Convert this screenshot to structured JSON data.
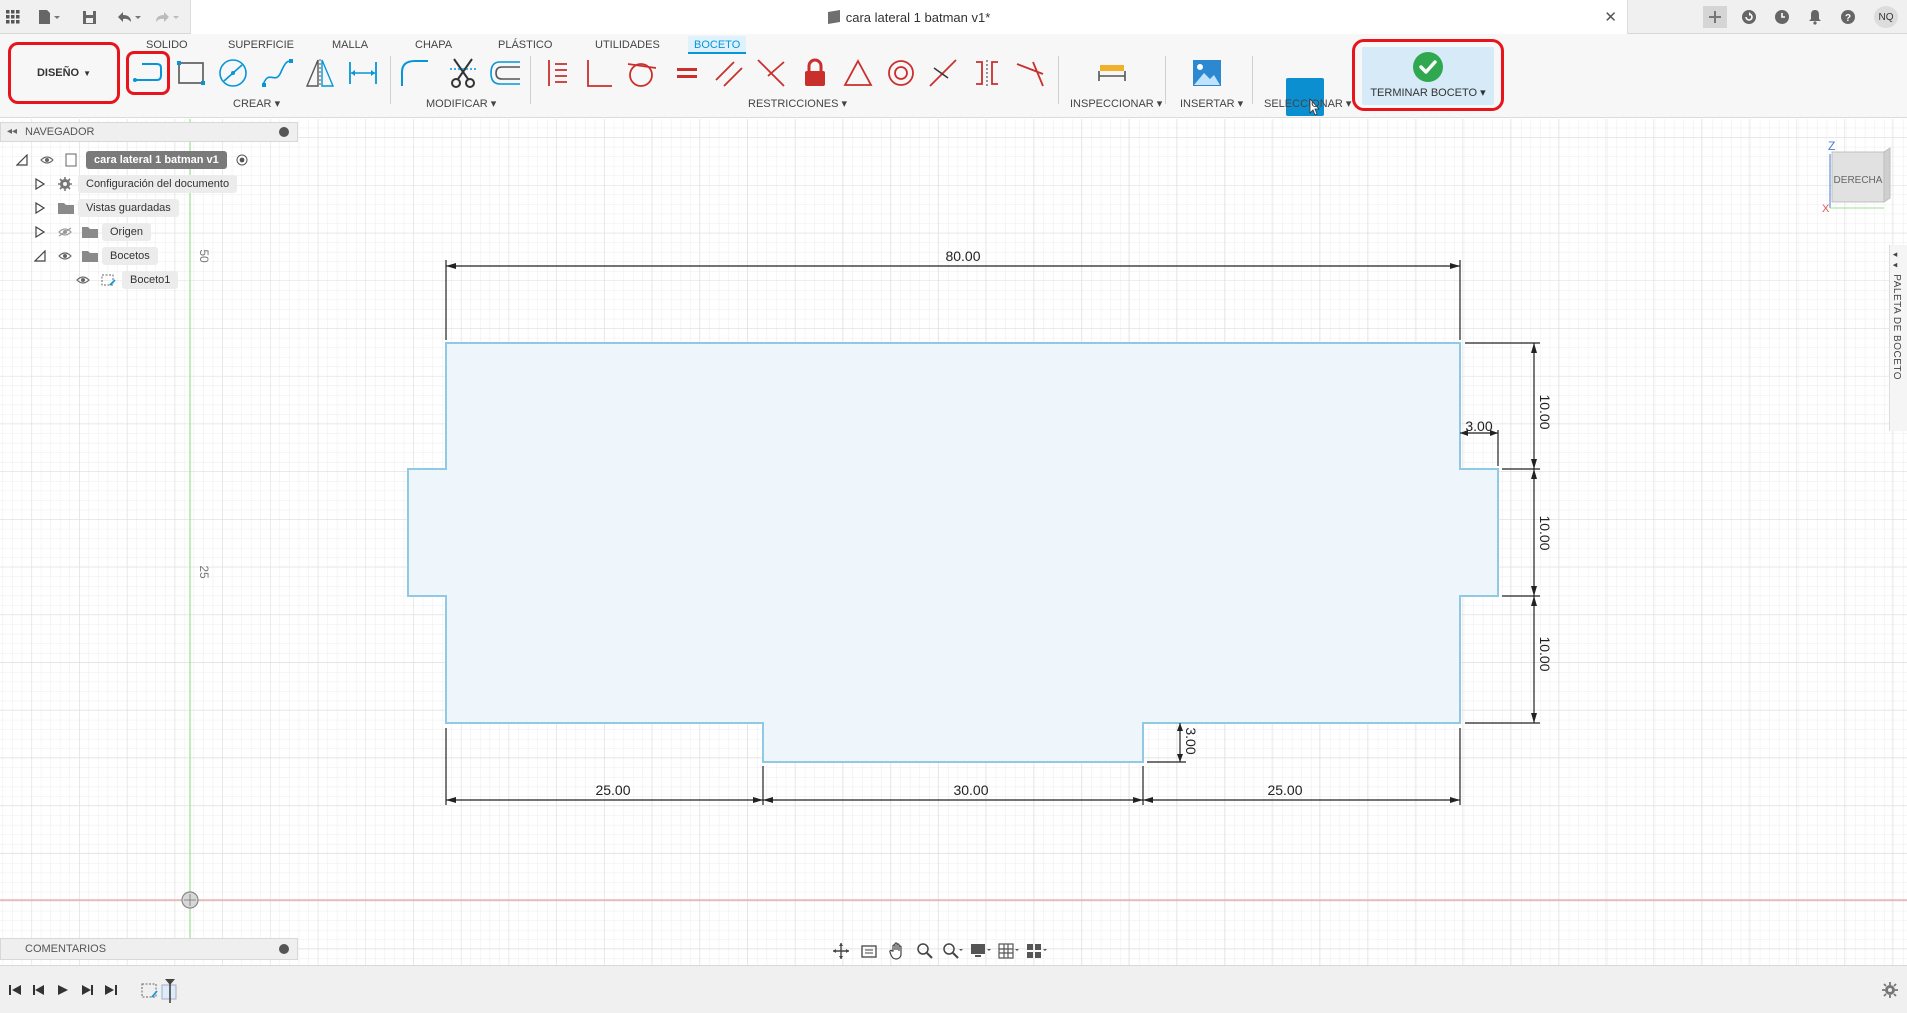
{
  "titlebar": {
    "document_title": "cara lateral 1 batman v1*",
    "close_glyph": "✕",
    "avatar_initials": "NQ",
    "icons": [
      "grid-icon",
      "file-icon",
      "save-icon",
      "undo-icon",
      "redo-icon",
      "add-tab-icon",
      "refresh-icon",
      "clock-icon",
      "bell-icon",
      "help-icon"
    ]
  },
  "ribbon": {
    "workspace_tabs": [
      "SOLIDO",
      "SUPERFICIE",
      "MALLA",
      "CHAPA",
      "PLÁSTICO",
      "UTILIDADES",
      "BOCETO"
    ],
    "active_tab": "BOCETO",
    "workspace_button": "DISEÑO",
    "groups": {
      "crear": "CREAR",
      "modificar": "MODIFICAR",
      "restricciones": "RESTRICCIONES",
      "inspeccionar": "INSPECCIONAR",
      "insertar": "INSERTAR",
      "seleccionar": "SELECCIONAR",
      "terminar": "TERMINAR BOCETO"
    },
    "colors": {
      "accent": "#0696d7",
      "highlight_red": "#e8141c",
      "finish_green": "#2fa84f"
    }
  },
  "browser": {
    "header": "NAVEGADOR",
    "items": [
      {
        "label": "cara lateral 1 batman v1"
      },
      {
        "label": "Configuración del documento"
      },
      {
        "label": "Vistas guardadas"
      },
      {
        "label": "Origen"
      },
      {
        "label": "Bocetos"
      },
      {
        "label": "Boceto1"
      }
    ]
  },
  "canvas": {
    "axis_labels": {
      "mark_50": "50",
      "mark_25": "25"
    },
    "viewcube": {
      "face": "DERECHA",
      "z_axis": "Z",
      "x_axis": "X"
    },
    "dimensions": {
      "overall_width": "80.00",
      "right_top": "10.00",
      "right_middle": "10.00",
      "right_bottom": "10.00",
      "tab_depth_right": "3.00",
      "notch_depth_bottom": "3.00",
      "bottom_left": "25.00",
      "bottom_middle": "30.00",
      "bottom_right": "25.00"
    },
    "sketch_color": "#8fc9e4",
    "sketch_fill": "#eef5fb"
  },
  "paleta": {
    "label": "PALETA DE BOCETO"
  },
  "comments": {
    "label": "COMENTARIOS"
  },
  "timeline": {
    "icons": [
      "first-icon",
      "prev-icon",
      "play-icon",
      "next-icon",
      "last-icon",
      "sketch-feature-icon",
      "settings-icon"
    ]
  }
}
